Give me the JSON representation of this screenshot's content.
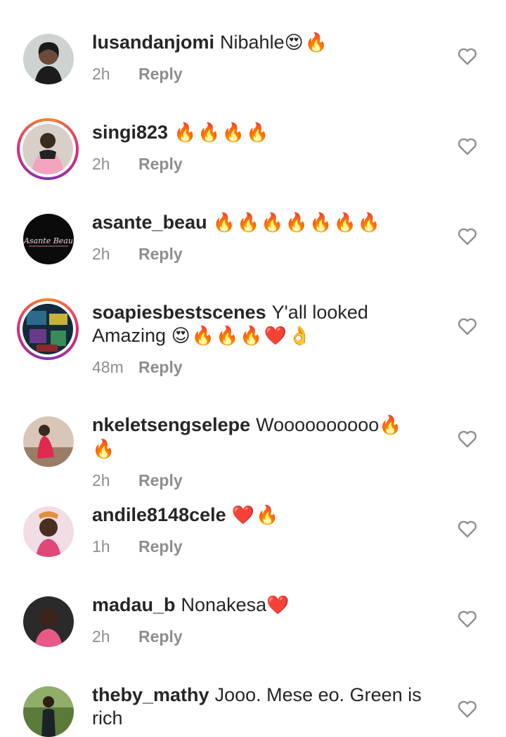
{
  "comments": [
    {
      "username": "lusandanjomi",
      "text": "Nibahle",
      "emoji": "😍🔥",
      "time": "2h",
      "reply": "Reply"
    },
    {
      "username": "singi823",
      "text": "",
      "emoji": "🔥🔥🔥🔥",
      "time": "2h",
      "reply": "Reply"
    },
    {
      "username": "asante_beau",
      "text": "",
      "emoji": "🔥🔥🔥🔥🔥🔥🔥",
      "time": "2h",
      "reply": "Reply"
    },
    {
      "username": "soapiesbestscenes",
      "text": "Y'all looked Amazing",
      "emoji": "😍🔥🔥🔥❤️👌",
      "time": "48m",
      "reply": "Reply"
    },
    {
      "username": "nkeletsengselepe",
      "text": "Woooooooooo",
      "emoji": "🔥🔥",
      "time": "2h",
      "reply": "Reply"
    },
    {
      "username": "andile8148cele",
      "text": "",
      "emoji": "❤️🔥",
      "time": "1h",
      "reply": "Reply"
    },
    {
      "username": "madau_b",
      "text": "Nonakesa",
      "emoji": "❤️",
      "time": "2h",
      "reply": "Reply"
    },
    {
      "username": "theby_mathy",
      "text": "Jooo. Mese eo. Green is rich",
      "emoji": "",
      "time": "",
      "reply": ""
    }
  ],
  "avatar_logo_text": "Asante Beau",
  "colors": {
    "text": "#262626",
    "muted": "#8e8e8e",
    "background": "#ffffff"
  }
}
